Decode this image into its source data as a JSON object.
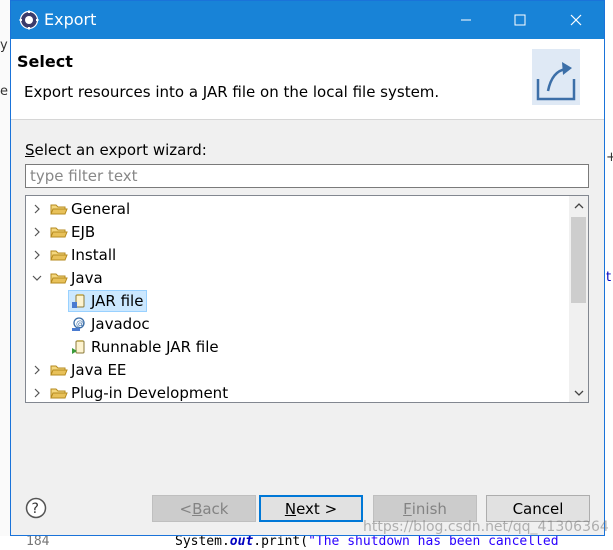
{
  "window": {
    "title": "Export",
    "minimize": "—",
    "maximize": "☐",
    "close": "✕"
  },
  "header": {
    "title": "Select",
    "description": "Export resources into a JAR file on the local file system."
  },
  "wizard_label": {
    "mnemonic": "S",
    "rest": "elect an export wizard:"
  },
  "filter": {
    "placeholder": "type filter text",
    "value": ""
  },
  "tree": {
    "items": [
      {
        "label": "General",
        "expanded": false
      },
      {
        "label": "EJB",
        "expanded": false
      },
      {
        "label": "Install",
        "expanded": false
      },
      {
        "label": "Java",
        "expanded": true
      },
      {
        "label": "JAR file",
        "child": true,
        "selected": true
      },
      {
        "label": "Javadoc",
        "child": true
      },
      {
        "label": "Runnable JAR file",
        "child": true
      },
      {
        "label": "Java EE",
        "expanded": false
      },
      {
        "label": "Plug-in Development",
        "expanded": false
      }
    ]
  },
  "buttons": {
    "back": {
      "mnemonic": "B",
      "prefix": "< ",
      "rest": "ack"
    },
    "next": {
      "mnemonic": "N",
      "rest": "ext >"
    },
    "finish": {
      "mnemonic": "F",
      "rest": "inish"
    },
    "cancel": "Cancel"
  },
  "background": {
    "line_number": "184",
    "code_prefix": "System.",
    "code_kw": "out",
    "code_mid": ".print(",
    "code_str": "\"The shutdown has been cancelled",
    "edge_y": "y",
    "edge_e": "e",
    "edge_plus": "+",
    "edge_t": "t"
  },
  "watermark": "https://blog.csdn.net/qq_41306364",
  "colors": {
    "titlebar": "#1883d7",
    "selection": "#cce8ff",
    "folder": "#e8c15a",
    "default_border": "#0078d7"
  }
}
